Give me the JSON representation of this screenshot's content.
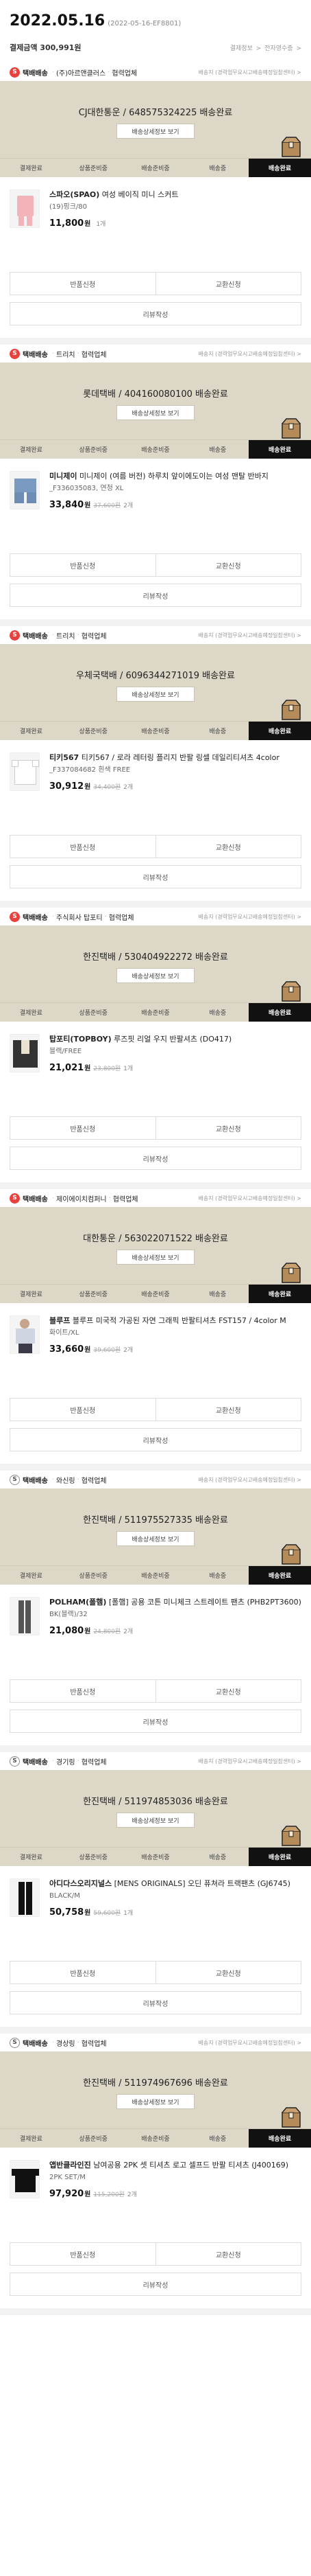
{
  "header": {
    "date": "2022.05.16",
    "order_no": "(2022-05-16-EF8801)",
    "payment_label": "결제금액 300,991원",
    "links": [
      "결제정보",
      ">",
      "전자영수증",
      ">"
    ]
  },
  "steps": [
    "결제완료",
    "상품준비중",
    "배송준비중",
    "배송중",
    "배송완료"
  ],
  "track_button": "배송상세정보 보기",
  "buttons": {
    "return": "반품신청",
    "exchange": "교환신청",
    "review": "리뷰작성"
  },
  "orders": [
    {
      "badge": "S",
      "ship_type": "택배배송",
      "seller": "(주)아르앤클러스",
      "contact": "협력업체",
      "right": "배송지 (경력업무요시고배송예정일참센터) >",
      "tracking": "CJ대한통운 / 648575324225 배송완료",
      "product_name": "스파오(SPAO)",
      "product_desc": "여성 베이직 미니 스커트",
      "option": "(19)핑크/80",
      "price": "11,800",
      "orig": "",
      "qty": "1개",
      "thumb": "t-pink"
    },
    {
      "badge": "S",
      "ship_type": "택배배송",
      "seller": "트리치",
      "contact": "협력업체",
      "right": "배송지 (경력업무요시고배송예정일참센터) >",
      "tracking": "롯데택배 / 404160080100 배송완료",
      "product_name": "미니제이",
      "product_desc": "미니제이 (여름 버전) 하루치 앞이에도이는 여성 맨탈 반바지",
      "option": "_F336035083, 연청 XL",
      "price": "33,840",
      "orig": "37,600원",
      "qty": "2개",
      "thumb": "t-denim"
    },
    {
      "badge": "S",
      "ship_type": "택배배송",
      "seller": "트리치",
      "contact": "협력업체",
      "right": "배송지 (경력업무요시고배송예정일참센터) >",
      "tracking": "우체국택배 / 6096344271019 배송완료",
      "product_name": "티키567",
      "product_desc": "티키567 / 로라 레터링 플리지 반팔 링셀 데일리티셔츠 4color",
      "option": "_F337084682 흰색 FREE",
      "price": "30,912",
      "orig": "34,400원",
      "qty": "2개",
      "thumb": "t-tee"
    },
    {
      "badge": "S",
      "ship_type": "택배배송",
      "seller": "주식회사 탑포티",
      "contact": "협력업체",
      "right": "배송지 (경력업무요시고배송예정일참센터) >",
      "tracking": "한진택배 / 530404922272 배송완료",
      "product_name": "탑포티(TOPBOY)",
      "product_desc": "루즈핏 리얼 우지 반팔셔츠 (DO417)",
      "option": "블랙/FREE",
      "price": "21,021",
      "orig": "23,800원",
      "qty": "1개",
      "thumb": "t-dark"
    },
    {
      "badge": "S",
      "ship_type": "택배배송",
      "seller": "제이에이치컴퍼니",
      "contact": "협력업체",
      "right": "배송지 (경력업무요시고배송예정일참센터) >",
      "tracking": "대한통운 / 563022071522 배송완료",
      "product_name": "블루프",
      "product_desc": "블루프 미국적 가공된 자연 그래픽 반팔티셔츠 FST157 / 4color M",
      "option": "화이트/XL",
      "price": "33,660",
      "orig": "39,600원",
      "qty": "2개",
      "thumb": "t-person"
    },
    {
      "badge": "S",
      "ship_type": "택배배송",
      "seller": "와신링",
      "contact": "협력업체",
      "right": "배송지 (경력업무요시고배송예정일참센터) >",
      "tracking": "한진택배 / 511975527335 배송완료",
      "product_name": "POLHAM(폴햄)",
      "product_desc": "[폴햄] 공용 코튼 미니체크 스트레이트 팬츠 (PHB2PT3600)",
      "option": "BK(블랙)/32",
      "price": "21,080",
      "orig": "24,800원",
      "qty": "2개",
      "thumb": "t-pants"
    },
    {
      "badge": "S",
      "ship_type": "택배배송",
      "seller": "경기링",
      "contact": "협력업체",
      "right": "배송지 (경력업무요시고배송예정일참센터) >",
      "tracking": "한진택배 / 511974853036 배송완료",
      "product_name": "아디다스오리지널스",
      "product_desc": "[MENS ORIGINALS] 오딘 퓨쳐라 트랙팬츠 (GJ6745)",
      "option": "BLACK/M",
      "price": "50,758",
      "orig": "59,600원",
      "qty": "1개",
      "thumb": "t-black"
    },
    {
      "badge": "S",
      "ship_type": "택배배송",
      "seller": "경상링",
      "contact": "협력업체",
      "right": "배송지 (경력업무요시고배송예정일참센터) >",
      "tracking": "한진택배 / 511974967696 배송완료",
      "product_name": "앱반클라인진",
      "product_desc": "남여공용 2PK 셋 티셔츠 로고 셀프드 반팔 티셔츠 (J400169)",
      "option": "2PK SET/M",
      "price": "97,920",
      "orig": "115,200원",
      "qty": "2개",
      "thumb": "t-btee"
    }
  ]
}
